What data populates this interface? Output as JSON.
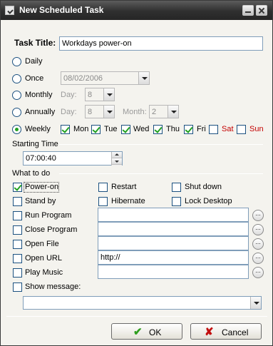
{
  "window": {
    "title": "New Scheduled Task"
  },
  "task_title": {
    "label": "Task Title:",
    "value": "Workdays power-on"
  },
  "schedule": {
    "daily_label": "Daily",
    "once_label": "Once",
    "once_date": "08/02/2006",
    "monthly_label": "Monthly",
    "monthly_day_label": "Day:",
    "monthly_day_value": "8",
    "annually_label": "Annually",
    "annually_day_label": "Day:",
    "annually_day_value": "8",
    "annually_month_label": "Month:",
    "annually_month_value": "2",
    "weekly_label": "Weekly",
    "selected": "Weekly",
    "days": [
      {
        "label": "Mon",
        "checked": true
      },
      {
        "label": "Tue",
        "checked": true
      },
      {
        "label": "Wed",
        "checked": true
      },
      {
        "label": "Thu",
        "checked": true
      },
      {
        "label": "Fri",
        "checked": true
      },
      {
        "label": "Sat",
        "checked": false
      },
      {
        "label": "Sun",
        "checked": false
      }
    ]
  },
  "starting_time": {
    "label": "Starting Time",
    "value": "07:00:40"
  },
  "what_to_do": {
    "label": "What to do",
    "power_on": "Power-on",
    "restart": "Restart",
    "shut_down": "Shut down",
    "stand_by": "Stand by",
    "hibernate": "Hibernate",
    "lock_desktop": "Lock Desktop",
    "run_program": "Run Program",
    "run_program_value": "",
    "close_program": "Close Program",
    "close_program_value": "",
    "open_file": "Open File",
    "open_file_value": "",
    "open_url": "Open URL",
    "open_url_value": "http://",
    "play_music": "Play Music",
    "play_music_value": "",
    "show_message": "Show message:",
    "show_message_value": "",
    "browse_label": "..."
  },
  "buttons": {
    "ok": "OK",
    "cancel": "Cancel"
  },
  "colors": {
    "title_bar": "#2f2f2f",
    "check_green": "#21a121",
    "weekend_red": "#c40000",
    "ok_icon": "#2e9e1e",
    "cancel_icon": "#c21010"
  }
}
